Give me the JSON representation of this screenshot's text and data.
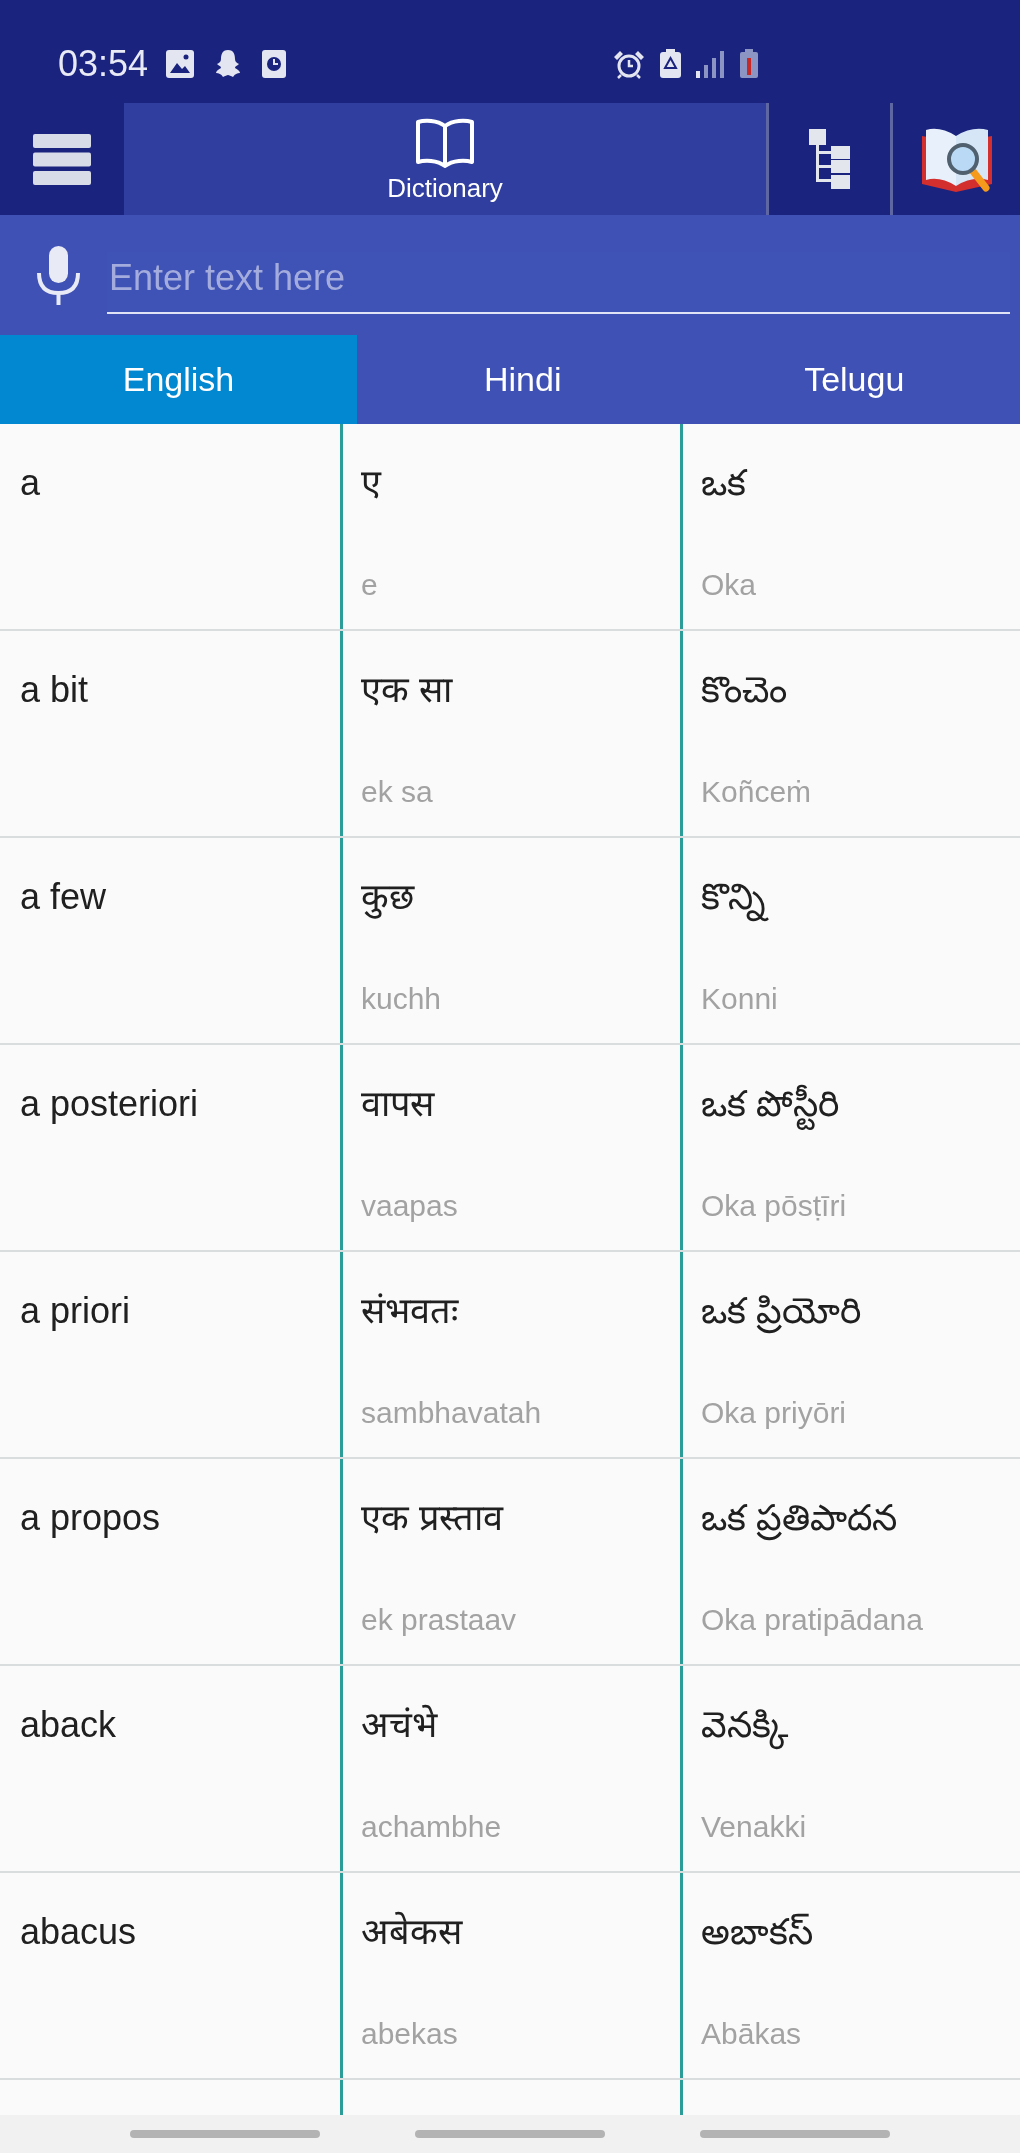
{
  "status_bar": {
    "time": "03:54"
  },
  "toolbar": {
    "tabs": [
      {
        "kind": "dictionary",
        "label": "Dictionary",
        "selected": true
      },
      {
        "kind": "tree",
        "selected": false
      },
      {
        "kind": "book_search",
        "selected": false
      }
    ]
  },
  "search": {
    "placeholder": "Enter text here"
  },
  "language_tabs": [
    {
      "label": "English",
      "selected": true
    },
    {
      "label": "Hindi",
      "selected": false
    },
    {
      "label": "Telugu",
      "selected": false
    }
  ],
  "entries": [
    {
      "english": "a",
      "hindi": "ए",
      "hindi_roman": "e",
      "telugu": "ఒక",
      "telugu_roman": "Oka"
    },
    {
      "english": "a bit",
      "hindi": "एक सा",
      "hindi_roman": "ek sa",
      "telugu": "కొంచెం",
      "telugu_roman": "Koñceṁ"
    },
    {
      "english": "a few",
      "hindi": "कुछ",
      "hindi_roman": "kuchh",
      "telugu": "కొన్ని",
      "telugu_roman": "Konni"
    },
    {
      "english": "a posteriori",
      "hindi": "वापस",
      "hindi_roman": "vaapas",
      "telugu": "ఒక పోస్టీరి",
      "telugu_roman": "Oka pōsṭīri"
    },
    {
      "english": "a priori",
      "hindi": "संभवतः",
      "hindi_roman": "sambhavatah",
      "telugu": "ఒక ప్రియోరి",
      "telugu_roman": "Oka priyōri"
    },
    {
      "english": "a propos",
      "hindi": "एक प्रस्ताव",
      "hindi_roman": "ek prastaav",
      "telugu": "ఒక ప్రతిపాదన",
      "telugu_roman": "Oka pratipādana"
    },
    {
      "english": "aback",
      "hindi": "अचंभे",
      "hindi_roman": "achambhe",
      "telugu": "వెనక్కి",
      "telugu_roman": "Venakki"
    },
    {
      "english": "abacus",
      "hindi": "अबेकस",
      "hindi_roman": "abekas",
      "telugu": "అబాకస్",
      "telugu_roman": "Abākas"
    }
  ]
}
